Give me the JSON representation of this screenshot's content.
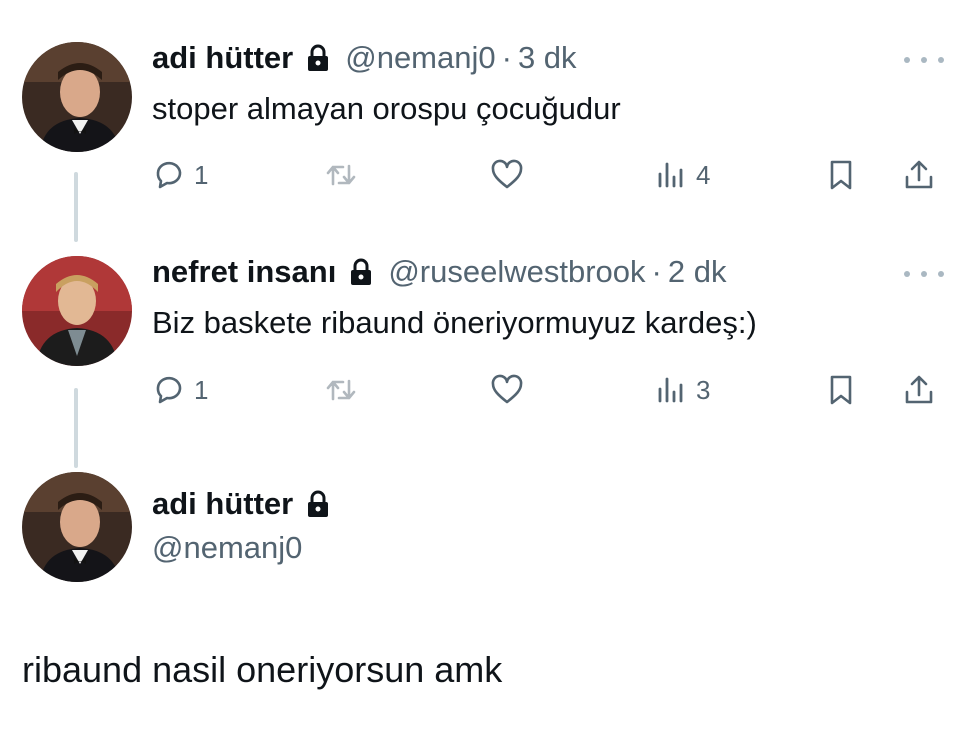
{
  "tweets": [
    {
      "name": "adi hütter",
      "handle": "@nemanj0",
      "dot": "·",
      "time": "3 dk",
      "text": "stoper almayan orospu çocuğudur",
      "replies": "1",
      "views": "4"
    },
    {
      "name": "nefret insanı",
      "handle": "@ruseelwestbrook",
      "dot": "·",
      "time": "2 dk",
      "text": "Biz baskete ribaund öneriyormuyuz kardeş:)",
      "replies": "1",
      "views": "3"
    }
  ],
  "reply": {
    "name": "adi hütter",
    "handle": "@nemanj0",
    "text": "ribaund nasil oneriyorsun amk"
  },
  "icons": {
    "verified_lock": "lock-icon",
    "reply": "reply-icon",
    "retweet": "retweet-icon",
    "like": "heart-icon",
    "views": "views-icon",
    "bookmark": "bookmark-icon",
    "share": "share-icon",
    "more": "more-icon"
  },
  "colors": {
    "text": "#0f1419",
    "secondary": "#536471",
    "thread_line": "#cfd9de"
  }
}
